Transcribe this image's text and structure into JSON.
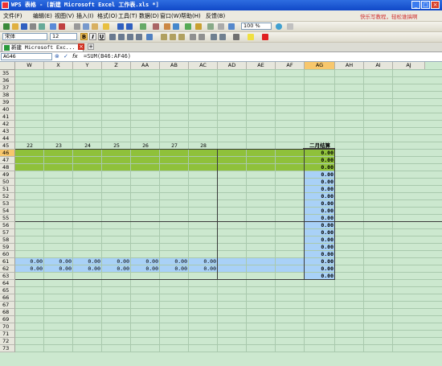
{
  "window": {
    "title": "WPS 表格 - [新建 Microsoft Excel 工作表.xls *]",
    "controls": [
      "_",
      "□",
      "×"
    ]
  },
  "menubar": {
    "items": [
      "文件(F)",
      "编辑(E)",
      "视图(V)",
      "插入(I)",
      "格式(O)",
      "工具(T)",
      "数据(D)",
      "窗口(W)",
      "帮助(H)",
      "反馈(B)"
    ],
    "hint": "快乐写教程，轻松谁搞啊"
  },
  "toolbar": {
    "zoom": "100 %",
    "font_name": "宋体",
    "font_size": "12",
    "bold": "B",
    "italic": "I",
    "underline": "U"
  },
  "tabs": {
    "document": "新建 Microsoft Exc...",
    "close": "×",
    "new": "+"
  },
  "formula_bar": {
    "name_box": "AG46",
    "fx": "fx",
    "formula": "=SUM(B46:AF46)"
  },
  "sheet": {
    "columns": [
      "W",
      "X",
      "Y",
      "Z",
      "AA",
      "AB",
      "AC",
      "AD",
      "AE",
      "AF",
      "AG",
      "AH",
      "AI",
      "AJ"
    ],
    "rows": [
      "35",
      "36",
      "37",
      "38",
      "39",
      "40",
      "41",
      "42",
      "43",
      "44",
      "45",
      "46",
      "47",
      "48",
      "49",
      "50",
      "51",
      "52",
      "53",
      "54",
      "55",
      "56",
      "57",
      "58",
      "59",
      "60",
      "61",
      "62",
      "63",
      "64",
      "65",
      "66",
      "67",
      "68",
      "69",
      "70",
      "71",
      "72",
      "73"
    ],
    "row45_days": [
      "22",
      "23",
      "24",
      "25",
      "26",
      "27",
      "28"
    ],
    "summary_header": "二月结算",
    "summary_values": [
      "0.00",
      "0.00",
      "0.00",
      "0.00",
      "0.00",
      "0.00",
      "0.00",
      "0.00",
      "0.00",
      "0.00",
      "0.00",
      "0.00",
      "0.00",
      "0.00",
      "0.00",
      "0.00",
      "0.00",
      "0.00"
    ],
    "row61_values": [
      "0.00",
      "0.00",
      "0.00",
      "0.00",
      "0.00",
      "0.00",
      "0.00"
    ],
    "row62_values": [
      "0.00",
      "0.00",
      "0.00",
      "0.00",
      "0.00",
      "0.00",
      "0.00"
    ],
    "colors": {
      "sheet_bg": "#cce8cf",
      "green_band": "#8fc13a",
      "blue_band": "#a9d1f7",
      "selected_header": "#f7c76c"
    }
  }
}
